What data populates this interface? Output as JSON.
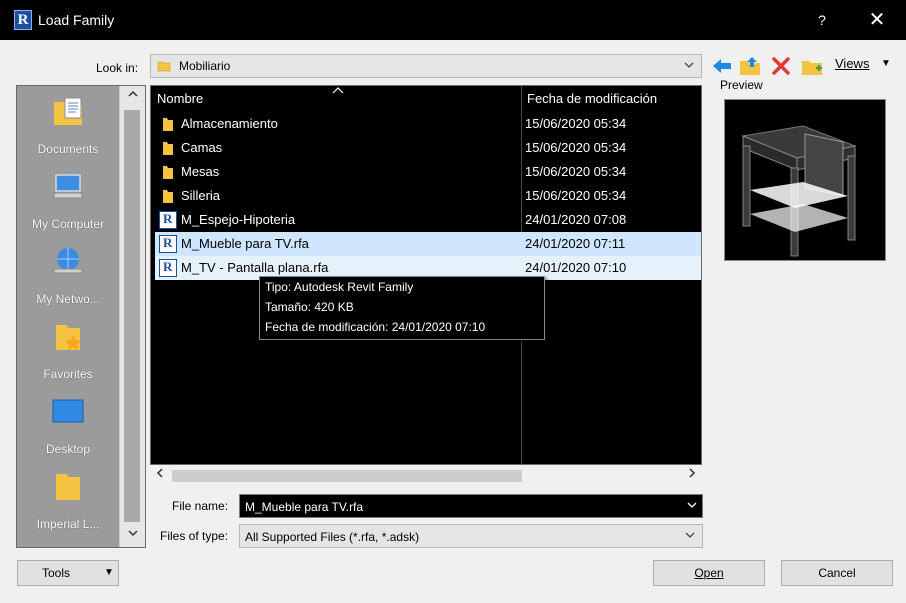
{
  "window": {
    "title": "Load Family",
    "app_icon_letter": "R",
    "help_label": "?",
    "close_label": "✕"
  },
  "lookin": {
    "label": "Look in:",
    "value": "Mobiliario"
  },
  "toolbar": {
    "icons": [
      "back-arrow-icon",
      "up-folder-icon",
      "delete-icon",
      "new-folder-icon"
    ],
    "views_label": "Views",
    "views_arrow": "▼"
  },
  "places": [
    {
      "label": "Documents",
      "icon": "documents-icon"
    },
    {
      "label": "My Computer",
      "icon": "my-computer-icon"
    },
    {
      "label": "My Netwo...",
      "icon": "my-network-icon"
    },
    {
      "label": "Favorites",
      "icon": "favorites-icon"
    },
    {
      "label": "Desktop",
      "icon": "desktop-icon"
    },
    {
      "label": "Imperial L...",
      "icon": "imperial-library-icon"
    }
  ],
  "filelist": {
    "columns": [
      "Nombre",
      "Fecha de modificación"
    ],
    "rows": [
      {
        "type": "folder",
        "name": "Almacenamiento",
        "date": "15/06/2020 05:34"
      },
      {
        "type": "folder",
        "name": "Camas",
        "date": "15/06/2020 05:34"
      },
      {
        "type": "folder",
        "name": "Mesas",
        "date": "15/06/2020 05:34"
      },
      {
        "type": "folder",
        "name": "Silleria",
        "date": "15/06/2020 05:34"
      },
      {
        "type": "rfa",
        "name": "M_Espejo-Hipoteria",
        "date": "24/01/2020 07:08"
      },
      {
        "type": "rfa",
        "name": "M_Mueble para TV.rfa",
        "date": "24/01/2020 07:11"
      },
      {
        "type": "rfa",
        "name": "M_TV - Pantalla plana.rfa",
        "date": "24/01/2020 07:10"
      }
    ]
  },
  "tooltip": {
    "tipo": "Tipo: Autodesk Revit Family",
    "tamano": "Tamaño: 420 KB",
    "fecha": "Fecha de modificación: 24/01/2020 07:10"
  },
  "preview": {
    "label": "Preview"
  },
  "filename": {
    "label": "File name:",
    "value": "M_Mueble para TV.rfa"
  },
  "filetype": {
    "label": "Files of type:",
    "value": "All Supported Files  (*.rfa, *.adsk)"
  },
  "buttons": {
    "tools": "Tools",
    "open": "Open",
    "cancel": "Cancel"
  },
  "colors": {
    "titlebar": "#000000",
    "selection": "#cfe6ff",
    "folder": "#f4c342",
    "revit_blue": "#1d4fa0"
  }
}
